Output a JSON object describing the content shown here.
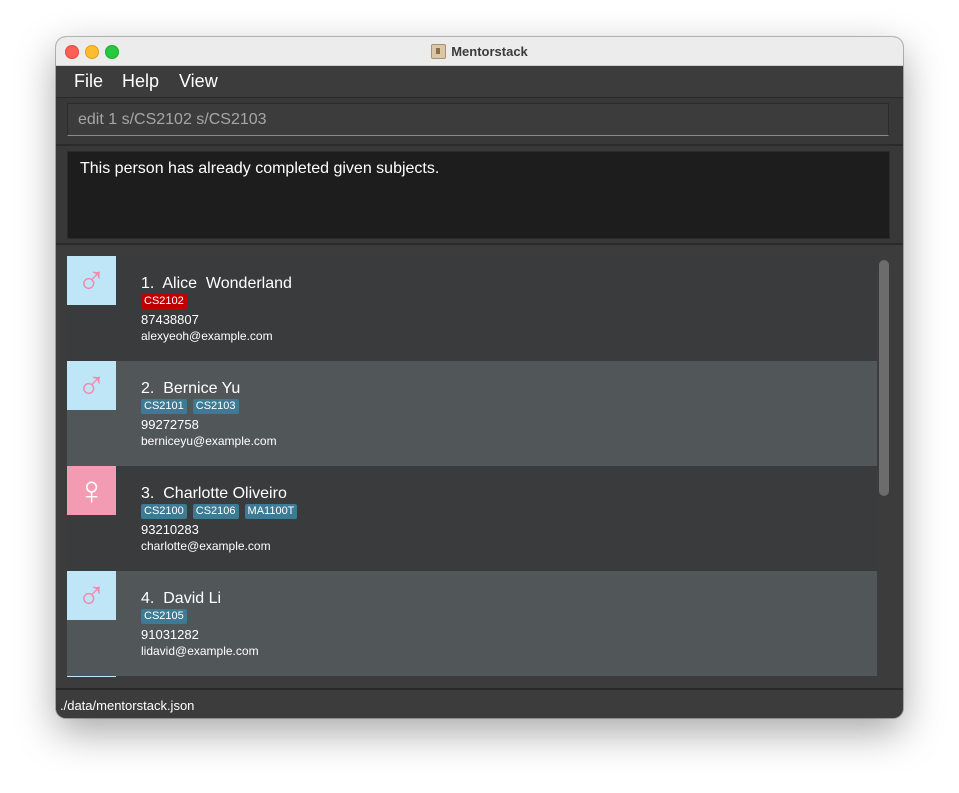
{
  "window": {
    "title": "Mentorstack"
  },
  "menu": {
    "file": "File",
    "help": "Help",
    "view": "View"
  },
  "command": {
    "value": "edit 1 s/CS2102 s/CS2103"
  },
  "result": {
    "message": "This person has already completed given subjects."
  },
  "persons": [
    {
      "index": "1.",
      "name": "Alice  Wonderland",
      "gender": "male",
      "icon": "male-icon",
      "tags": [
        {
          "label": "CS2102",
          "status": "error"
        }
      ],
      "phone": "87438807",
      "email": "alexyeoh@example.com"
    },
    {
      "index": "2.",
      "name": "Bernice Yu",
      "gender": "male",
      "icon": "male-icon",
      "tags": [
        {
          "label": "CS2101",
          "status": "normal"
        },
        {
          "label": "CS2103",
          "status": "normal"
        }
      ],
      "phone": "99272758",
      "email": "berniceyu@example.com"
    },
    {
      "index": "3.",
      "name": "Charlotte Oliveiro",
      "gender": "female",
      "icon": "female-icon",
      "tags": [
        {
          "label": "CS2100",
          "status": "normal"
        },
        {
          "label": "CS2106",
          "status": "normal"
        },
        {
          "label": "MA1100T",
          "status": "normal"
        }
      ],
      "phone": "93210283",
      "email": "charlotte@example.com"
    },
    {
      "index": "4.",
      "name": "David Li",
      "gender": "male",
      "icon": "male-icon",
      "tags": [
        {
          "label": "CS2105",
          "status": "normal"
        }
      ],
      "phone": "91031282",
      "email": "lidavid@example.com"
    }
  ],
  "status": {
    "file_path": "./data/mentorstack.json"
  },
  "colors": {
    "tag_normal": "#3d7a93",
    "tag_error": "#c00000",
    "male_bg": "#bfe6f7",
    "female_bg": "#f49bb4",
    "symbol_pink": "#f08bb0"
  }
}
